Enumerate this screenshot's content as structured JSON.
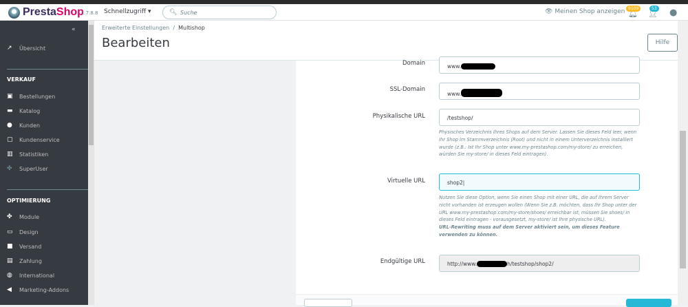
{
  "header": {
    "logo_brand": "PrestaShop",
    "version": "1.7.8.8",
    "quick_access": "Schnellzugriff",
    "search_placeholder": "Suche",
    "view_shop": "Meinen Shop anzeigen",
    "orders_badge": "9109",
    "customers_badge": "53"
  },
  "sidebar": {
    "overview": "Übersicht",
    "sections": [
      {
        "title": "VERKAUF",
        "items": [
          {
            "label": "Bestellungen",
            "icon": "basket-icon"
          },
          {
            "label": "Katalog",
            "icon": "store-icon"
          },
          {
            "label": "Kunden",
            "icon": "account-icon"
          },
          {
            "label": "Kundenservice",
            "icon": "chat-icon"
          },
          {
            "label": "Statistiken",
            "icon": "chart-icon"
          },
          {
            "label": "SuperUser",
            "icon": "puzzle-icon"
          }
        ]
      },
      {
        "title": "OPTIMIERUNG",
        "items": [
          {
            "label": "Module",
            "icon": "puzzle-icon"
          },
          {
            "label": "Design",
            "icon": "monitor-icon"
          },
          {
            "label": "Versand",
            "icon": "truck-icon"
          },
          {
            "label": "Zahlung",
            "icon": "card-icon"
          },
          {
            "label": "International",
            "icon": "globe-icon"
          },
          {
            "label": "Marketing-Addons",
            "icon": "megaphone-icon"
          }
        ]
      }
    ]
  },
  "page": {
    "breadcrumb_parent": "Erweiterte Einstellungen",
    "breadcrumb_sep": "/",
    "breadcrumb_current": "Multishop",
    "title": "Bearbeiten",
    "help_button": "Hilfe"
  },
  "form": {
    "domain_label": "Domain",
    "domain_value": "www.",
    "ssl_label": "SSL-Domain",
    "ssl_value": "www.",
    "physical_label": "Physikalische URL",
    "physical_value": "/testshop/",
    "physical_help": "Physisches Verzeichnis Ihres Shops auf dem Server. Lassen Sie dieses Feld leer, wenn Ihr Shop im Stammverzeichnis (Root) und nicht in einem Unterverzeichnis installiert wurde (z.B.: Ist Ihr Shop unter www.my-prestashop.com/my-store/ zu erreichen, würden Sie my-store/ in dieses Feld eintragen).",
    "virtual_label": "Virtuelle URL",
    "virtual_value": "shop2",
    "virtual_help": "Nutzen Sie diese Option, wenn Sie einen Shop mit einer URL, die auf Ihrem Server nicht vorhanden ist erzeugen wollen (Wenn Sie z.B. möchten, dass Ihr Shop unter der URL www.my-prestashop.com/my-store/shoes/ erreichbar ist, müssen Sie shoes/ in dieses Feld eintragen - vorausgesetzt, my-store/ ist Ihre physische URL).",
    "virtual_help_bold": "URL-Rewriting muss auf dem Server aktiviert sein, um dieses Feature verwenden zu können.",
    "final_label": "Endgültige URL",
    "final_prefix": "http://www.",
    "final_suffix": "h/testshop/shop2/"
  }
}
